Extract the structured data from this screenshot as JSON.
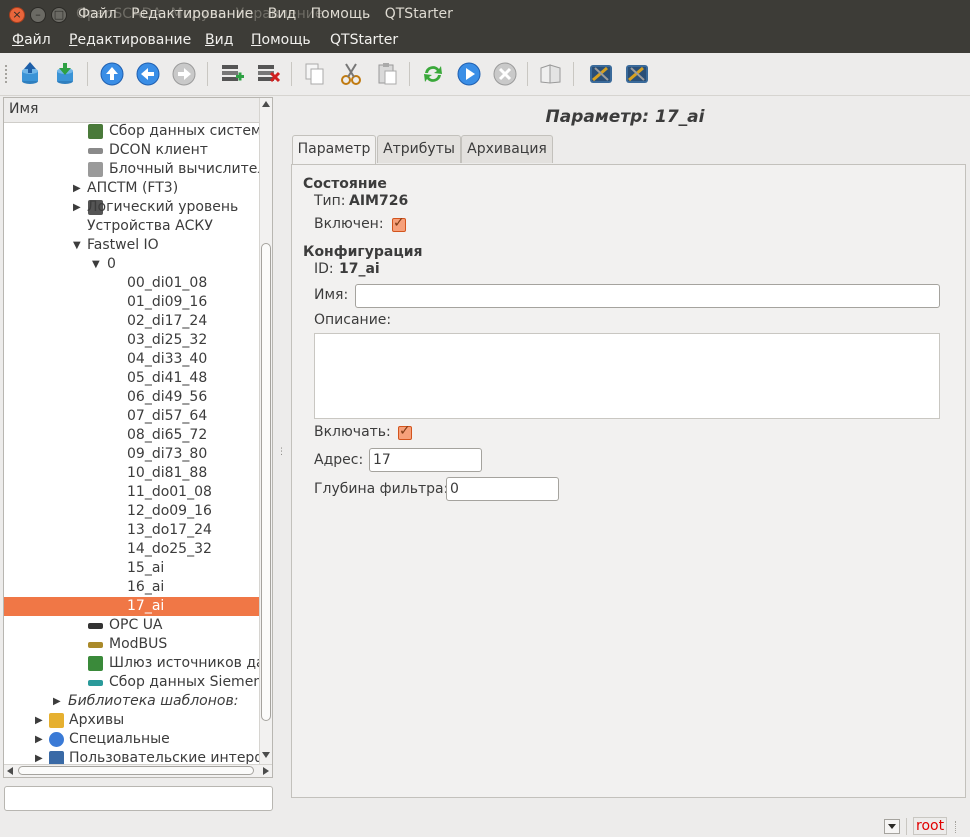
{
  "window": {
    "ghost_title": "OpenSCADA: Модуль: Управление",
    "title_menu": [
      "Файл",
      "Редактирование",
      "Вид",
      "Помощь",
      "QTStarter"
    ]
  },
  "menubar": {
    "items": [
      {
        "accel": "Ф",
        "rest": "айл"
      },
      {
        "accel": "Р",
        "rest": "едактирование"
      },
      {
        "accel": "В",
        "rest": "ид"
      },
      {
        "accel": "П",
        "rest": "омощь"
      },
      {
        "accel": "",
        "rest": "QTStarter"
      }
    ]
  },
  "toolbar": {
    "icons": [
      "db-load-icon",
      "db-save-icon",
      "up-icon",
      "back-icon",
      "forward-icon",
      "add-item-icon",
      "delete-item-icon",
      "copy-icon",
      "cut-icon",
      "paste-icon",
      "refresh-icon",
      "start-icon",
      "stop-icon",
      "help-icon",
      "qtcfg-icon",
      "qtcfg2-icon"
    ]
  },
  "tree": {
    "header": "Имя",
    "rows": [
      {
        "label": "Сбор данных системы",
        "indent": 2,
        "arrow": "",
        "icon": "system-icon"
      },
      {
        "label": "DCON клиент",
        "indent": 2,
        "arrow": "",
        "icon": "dcon-icon"
      },
      {
        "label": "Блочный вычислитель",
        "indent": 2,
        "arrow": "",
        "icon": "block-calc-icon"
      },
      {
        "label": "АПСТМ (FT3)",
        "indent": 1,
        "arrow": "▶",
        "icon": ""
      },
      {
        "label": "Логический уровень",
        "indent": 1,
        "arrow": "▶",
        "icon": "logic-level-icon"
      },
      {
        "label": "Устройства АСКУ",
        "indent": 1,
        "arrow": "",
        "icon": ""
      },
      {
        "label": "Fastwel IO",
        "indent": 1,
        "arrow": "▼",
        "icon": ""
      },
      {
        "label": "0",
        "indent": 2,
        "arrow": "▼",
        "icon": ""
      },
      {
        "label": "00_di01_08",
        "indent": 3,
        "arrow": "",
        "icon": ""
      },
      {
        "label": "01_di09_16",
        "indent": 3,
        "arrow": "",
        "icon": ""
      },
      {
        "label": "02_di17_24",
        "indent": 3,
        "arrow": "",
        "icon": ""
      },
      {
        "label": "03_di25_32",
        "indent": 3,
        "arrow": "",
        "icon": ""
      },
      {
        "label": "04_di33_40",
        "indent": 3,
        "arrow": "",
        "icon": ""
      },
      {
        "label": "05_di41_48",
        "indent": 3,
        "arrow": "",
        "icon": ""
      },
      {
        "label": "06_di49_56",
        "indent": 3,
        "arrow": "",
        "icon": ""
      },
      {
        "label": "07_di57_64",
        "indent": 3,
        "arrow": "",
        "icon": ""
      },
      {
        "label": "08_di65_72",
        "indent": 3,
        "arrow": "",
        "icon": ""
      },
      {
        "label": "09_di73_80",
        "indent": 3,
        "arrow": "",
        "icon": ""
      },
      {
        "label": "10_di81_88",
        "indent": 3,
        "arrow": "",
        "icon": ""
      },
      {
        "label": "11_do01_08",
        "indent": 3,
        "arrow": "",
        "icon": ""
      },
      {
        "label": "12_do09_16",
        "indent": 3,
        "arrow": "",
        "icon": ""
      },
      {
        "label": "13_do17_24",
        "indent": 3,
        "arrow": "",
        "icon": ""
      },
      {
        "label": "14_do25_32",
        "indent": 3,
        "arrow": "",
        "icon": ""
      },
      {
        "label": "15_ai",
        "indent": 3,
        "arrow": "",
        "icon": ""
      },
      {
        "label": "16_ai",
        "indent": 3,
        "arrow": "",
        "icon": ""
      },
      {
        "label": "17_ai",
        "indent": 3,
        "arrow": "",
        "icon": "",
        "selected": true
      },
      {
        "label": "OPC UA",
        "indent": 2,
        "arrow": "",
        "icon": "opc-ua-icon"
      },
      {
        "label": "ModBUS",
        "indent": 2,
        "arrow": "",
        "icon": "modbus-icon"
      },
      {
        "label": "Шлюз источников данных",
        "indent": 2,
        "arrow": "",
        "icon": "gateway-icon"
      },
      {
        "label": "Сбор данных Siemens",
        "indent": 2,
        "arrow": "",
        "icon": "siemens-icon"
      },
      {
        "label": "Библиотека шаблонов:",
        "indent": 0,
        "arrow": "▶",
        "icon": "",
        "italic": true
      },
      {
        "label": "Архивы",
        "indent": -1,
        "arrow": "▶",
        "icon": "archive-icon"
      },
      {
        "label": "Специальные",
        "indent": -1,
        "arrow": "▶",
        "icon": "special-icon"
      },
      {
        "label": "Пользовательские интерфейсы",
        "indent": -1,
        "arrow": "▶",
        "icon": "ui-icon"
      }
    ]
  },
  "param": {
    "title": "Параметр: 17_ai",
    "tabs": [
      "Параметр",
      "Атрибуты",
      "Архивация"
    ],
    "state_header": "Состояние",
    "type_label": "Тип:",
    "type_value": "AIM726",
    "enabled_label": "Включен:",
    "enabled": true,
    "config_header": "Конфигурация",
    "id_label": "ID:",
    "id_value": "17_ai",
    "name_label": "Имя:",
    "name_value": "",
    "descr_label": "Описание:",
    "descr_value": "",
    "to_enable_label": "Включать:",
    "to_enable": true,
    "addr_label": "Адрес:",
    "addr_value": "17",
    "filter_label": "Глубина фильтра:",
    "filter_value": "0"
  },
  "status": {
    "user": "root"
  },
  "colors": {
    "selection": "#f07746",
    "titlebar": "#3d3c37",
    "user_text": "#e00000"
  }
}
